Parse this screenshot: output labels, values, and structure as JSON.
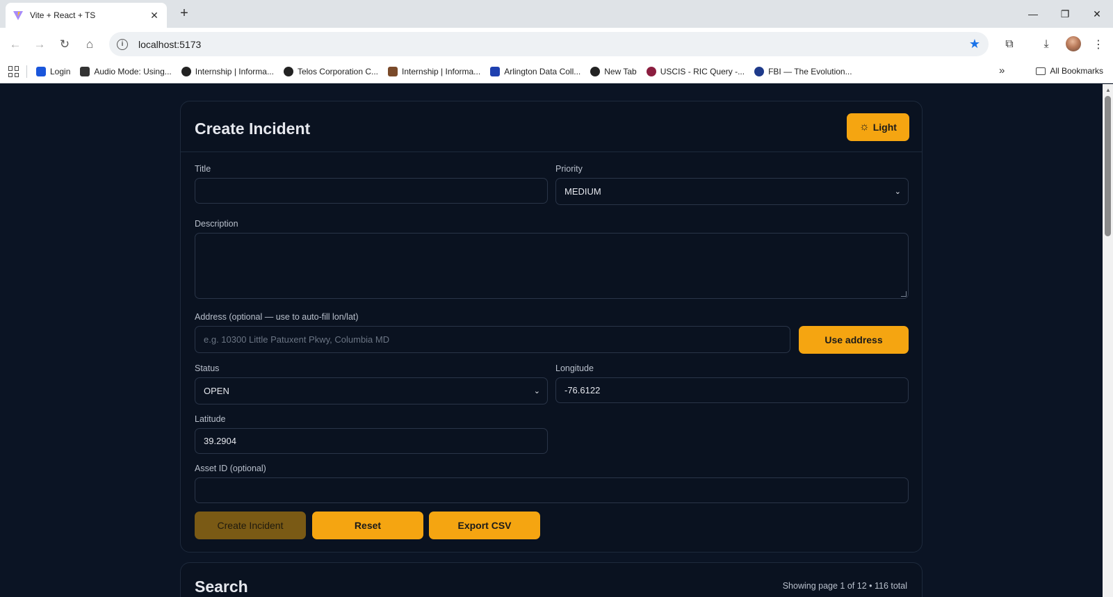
{
  "browser": {
    "tab_title": "Vite + React + TS",
    "url": "localhost:5173",
    "bookmarks": [
      {
        "label": "Login",
        "color": "#1a56db"
      },
      {
        "label": "Audio Mode: Using...",
        "color": "#333333"
      },
      {
        "label": "Internship | Informa...",
        "color": "#222222"
      },
      {
        "label": "Telos Corporation C...",
        "color": "#222222"
      },
      {
        "label": "Internship | Informa...",
        "color": "#7a4a2a"
      },
      {
        "label": "Arlington Data Coll...",
        "color": "#1e40af"
      },
      {
        "label": "New Tab",
        "color": "#222222"
      },
      {
        "label": "USCIS - RIC Query -...",
        "color": "#8b1e3f"
      },
      {
        "label": "FBI — The Evolution...",
        "color": "#1e3a8a"
      }
    ],
    "all_bookmarks_label": "All Bookmarks"
  },
  "create_card": {
    "title": "Create Incident",
    "theme_toggle_label": "Light",
    "title_label": "Title",
    "title_value": "",
    "priority_label": "Priority",
    "priority_value": "MEDIUM",
    "description_label": "Description",
    "description_value": "",
    "address_label": "Address (optional — use to auto-fill lon/lat)",
    "address_placeholder": "e.g. 10300 Little Patuxent Pkwy, Columbia MD",
    "use_address_label": "Use address",
    "status_label": "Status",
    "status_value": "OPEN",
    "longitude_label": "Longitude",
    "longitude_value": "-76.6122",
    "latitude_label": "Latitude",
    "latitude_value": "39.2904",
    "asset_label": "Asset ID (optional)",
    "asset_value": "",
    "create_button": "Create Incident",
    "reset_button": "Reset",
    "export_button": "Export CSV"
  },
  "search_card": {
    "title": "Search",
    "pagination_text": "Showing page 1 of 12 • 116 total"
  },
  "colors": {
    "accent": "#f5a511",
    "background": "#0b1424",
    "card": "#0a1220"
  }
}
